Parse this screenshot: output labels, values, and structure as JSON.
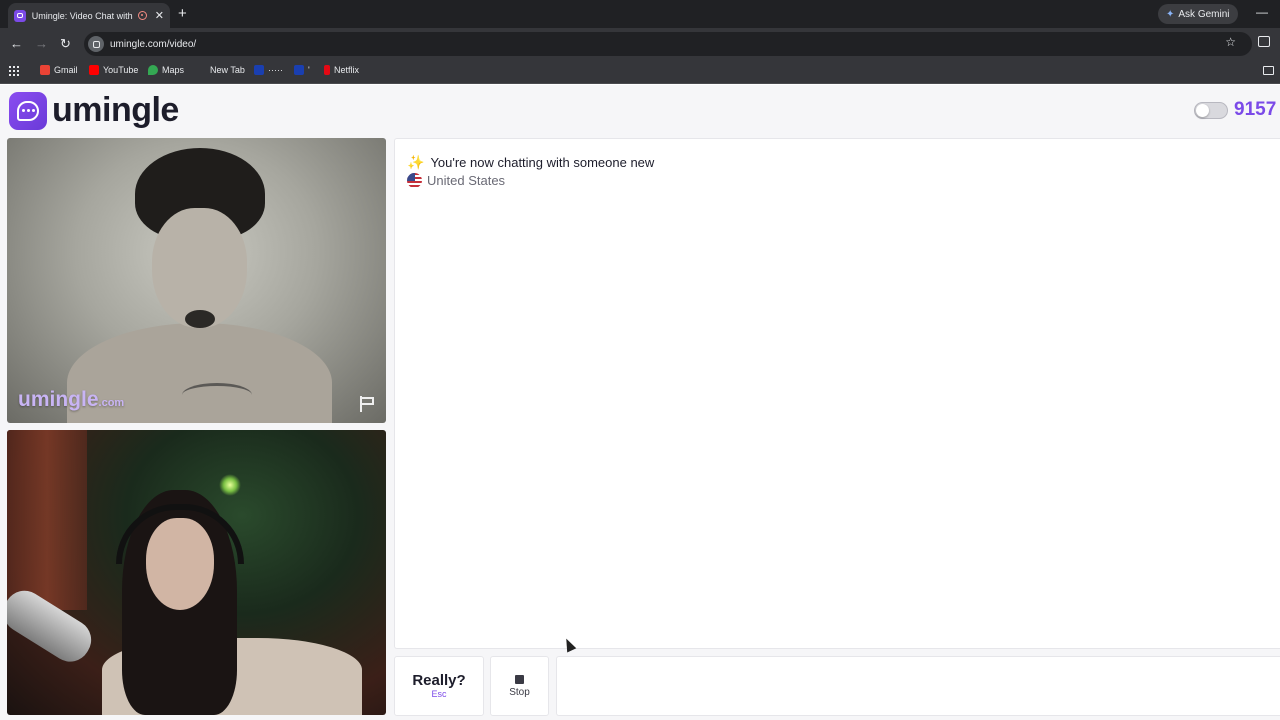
{
  "browser": {
    "tab_title": "Umingle: Video Chat with S",
    "url": "umingle.com/video/",
    "gemini_label": "Ask Gemini",
    "bookmarks": [
      {
        "label": "Gmail",
        "color": "#ea4335"
      },
      {
        "label": "YouTube",
        "color": "#ff0000"
      },
      {
        "label": "Maps",
        "color": "#34a853"
      },
      {
        "label": "New Tab",
        "color": ""
      },
      {
        "label": "·····",
        "color": "#1a3fb0"
      },
      {
        "label": "'",
        "color": "#1a3fb0"
      },
      {
        "label": "Netflix",
        "color": "#e50914"
      }
    ]
  },
  "header": {
    "logo_text": "umingle",
    "online_count": "9157",
    "toggle_on": false
  },
  "stranger_video": {
    "watermark_main": "umingle",
    "watermark_suffix": ".com"
  },
  "chat": {
    "status_message": "You're now chatting with someone new",
    "country": "United States",
    "sparkle_icon": "sparkles-icon",
    "flag_icon": "us-flag-icon"
  },
  "controls": {
    "really_label": "Really?",
    "really_shortcut": "Esc",
    "stop_label": "Stop",
    "message_placeholder": ""
  },
  "colors": {
    "brand": "#7b4ae8",
    "watermark": "#c8b4f4"
  }
}
